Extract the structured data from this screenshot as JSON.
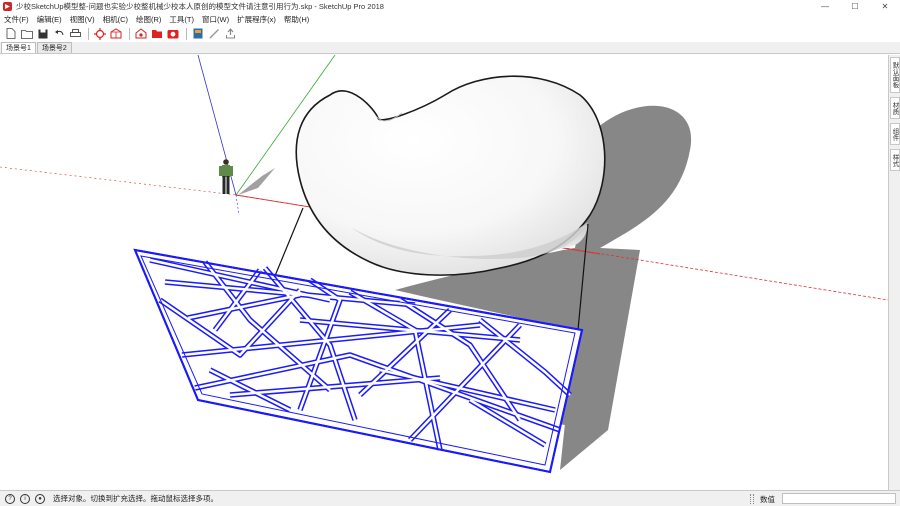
{
  "window": {
    "title": "少校SketchUp模型整-问题也实验少校整机械少校本人原创的模型文件请注意引用行为.skp - SketchUp Pro 2018",
    "controls": [
      "—",
      "☐",
      "✕"
    ]
  },
  "menu": [
    "文件(F)",
    "编辑(E)",
    "视图(V)",
    "相机(C)",
    "绘图(R)",
    "工具(T)",
    "窗口(W)",
    "扩展程序(x)",
    "帮助(H)"
  ],
  "toolbar": {
    "buttons": [
      "new-file-icon",
      "open-file-icon",
      "save-icon",
      "undo-icon",
      "print-icon",
      "model-info-icon",
      "component-icon",
      "warehouse-icon",
      "extension-warehouse-icon",
      "camera-icon",
      "layout-icon",
      "style-builder-icon",
      "share-icon"
    ]
  },
  "scene_tabs": [
    "场景号1",
    "场景号2"
  ],
  "tray_tabs": [
    "默认面板",
    "材质",
    "组件",
    "样式"
  ],
  "status": {
    "message": "选择对象。切换到扩充选择。拖动鼠标选择多项。",
    "measurements_label": "数值",
    "measurements_value": ""
  },
  "colors": {
    "axis_red": "#d33",
    "axis_green": "#3a3",
    "axis_blue": "#33c",
    "selection": "#1a1aff",
    "shadow": "#7d7d7d",
    "ground_shadow": "#898989"
  }
}
